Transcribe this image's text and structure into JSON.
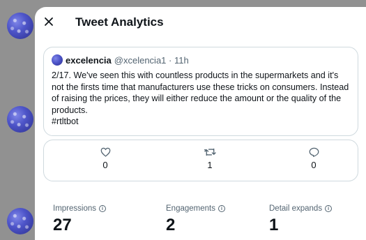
{
  "header": {
    "title": "Tweet Analytics",
    "close_icon": "close-icon"
  },
  "tweet": {
    "name": "excelencia",
    "handle_time": "@xcelencia1 · 11h",
    "text": "2/17. We've seen this with countless products in the supermarkets and it's not the firsts time that manufacturers use these tricks on consumers. Instead of raising the prices, they will either reduce the amount or the quality of the products.\n#rtltbot"
  },
  "actions": {
    "likes": "0",
    "retweets": "1",
    "replies": "0"
  },
  "metrics": [
    {
      "label": "Impressions",
      "value": "27"
    },
    {
      "label": "Engagements",
      "value": "2"
    },
    {
      "label": "Detail expands",
      "value": "1"
    }
  ],
  "colors": {
    "text_primary": "#0f1419",
    "text_secondary": "#536471",
    "border": "#cfd9de",
    "overlay": "#919191"
  }
}
